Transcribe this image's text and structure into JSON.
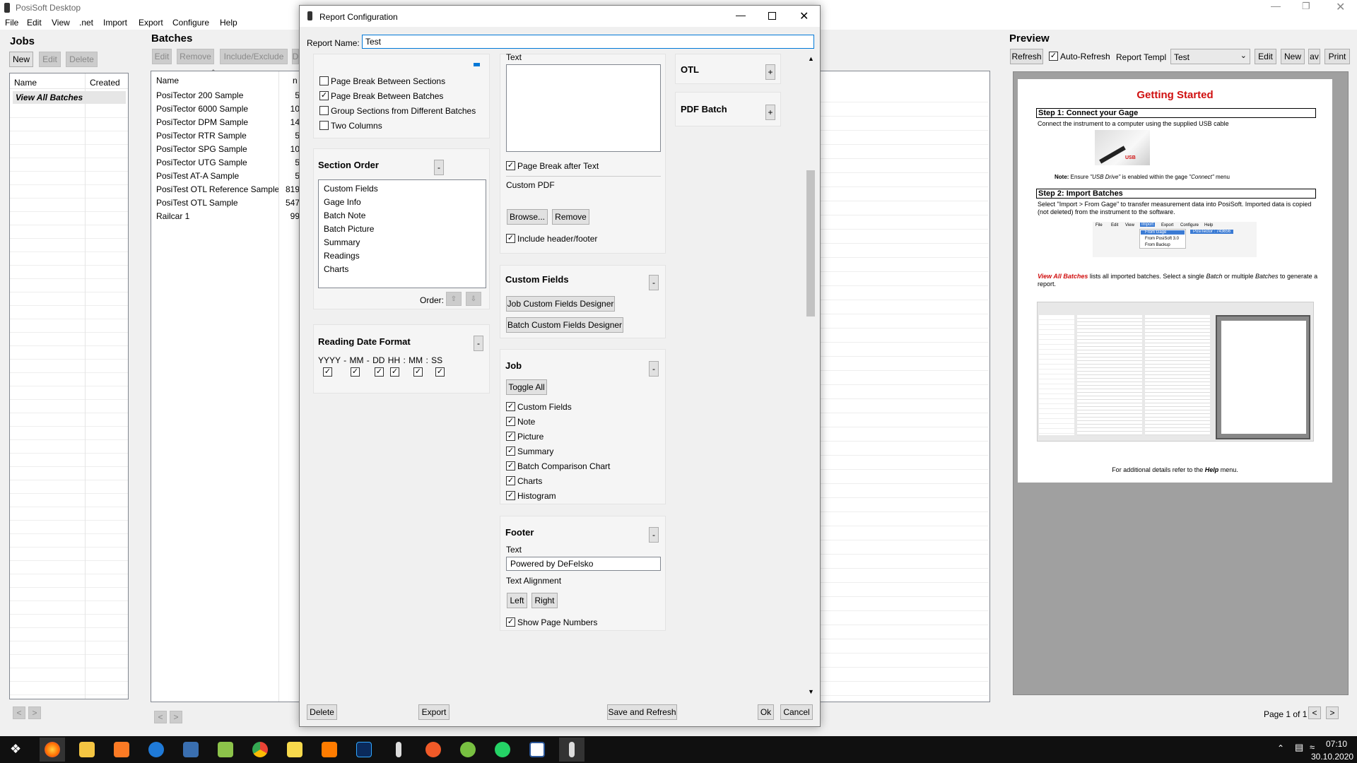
{
  "app": {
    "title": "PosiSoft Desktop",
    "menu": [
      "File",
      "Edit",
      "View",
      ".net",
      "Import",
      "Export",
      "Configure",
      "Help"
    ]
  },
  "jobs": {
    "title": "Jobs",
    "buttons": {
      "new": "New",
      "edit": "Edit",
      "delete": "Delete"
    },
    "columns": [
      "Name",
      "Created"
    ],
    "rows": [
      "View All Batches"
    ],
    "nav": {
      "prev": "<",
      "next": ">"
    }
  },
  "batches": {
    "title": "Batches",
    "buttons": {
      "edit": "Edit",
      "remove": "Remove",
      "include": "Include/Exclude",
      "extra": "D"
    },
    "columns": [
      "Name",
      "n"
    ],
    "rows": [
      {
        "name": "PosiTector 200 Sample",
        "n": "5"
      },
      {
        "name": "PosiTector 6000 Sample",
        "n": "10"
      },
      {
        "name": "PosiTector DPM Sample",
        "n": "14"
      },
      {
        "name": "PosiTector RTR Sample",
        "n": "5"
      },
      {
        "name": "PosiTector SPG Sample",
        "n": "10"
      },
      {
        "name": "PosiTector UTG Sample",
        "n": "5"
      },
      {
        "name": "PosiTest AT-A Sample",
        "n": "5"
      },
      {
        "name": "PosiTest OTL Reference Sample",
        "n": "819"
      },
      {
        "name": "PosiTest OTL Sample",
        "n": "547"
      },
      {
        "name": "Railcar 1",
        "n": "99"
      }
    ],
    "nav": {
      "prev": "<",
      "next": ">"
    }
  },
  "preview": {
    "title": "Preview",
    "refresh": "Refresh",
    "auto_refresh": "Auto-Refresh",
    "report_templ_label": "Report Templ",
    "report_templ_value": "Test",
    "edit": "Edit",
    "new": "New",
    "av": "av",
    "print": "Print",
    "page_info": "Page 1 of 1",
    "prev": "<",
    "next": ">",
    "doc": {
      "heading": "Getting Started",
      "step1": "Step 1: Connect your Gage",
      "step1_text": "Connect the instrument to a computer using the supplied USB cable",
      "usb_label": "USB",
      "note_bold": "Note:",
      "note_pre": " Ensure ",
      "note_usb": "\"USB Drive\"",
      "note_mid": " is enabled within the gage ",
      "note_connect": "\"Connect\"",
      "note_post": " menu",
      "step2": "Step 2: Import Batches",
      "step2_text": "Select \"Import > From Gage\" to transfer measurement data into PosiSoft.  Imported data is copied (not deleted) from the instrument to the software.",
      "menu_items": [
        "File",
        "Edit",
        "View",
        "Import",
        "Export",
        "Configure",
        "Help"
      ],
      "menu_sub": [
        "From Gage",
        "From PosiSoft 3.0",
        "From Backup"
      ],
      "menu_flyout": "PosiTector : 743656",
      "va_bold": "View All Batches",
      "va_text1": " lists all imported batches.  Select a single ",
      "va_batch": "Batch",
      "va_text2": " or multiple ",
      "va_batches": "Batches",
      "va_text3": " to generate a report.",
      "footer_pre": "For additional details refer to the ",
      "footer_help": "Help",
      "footer_post": " menu."
    }
  },
  "dialog": {
    "title": "Report Configuration",
    "report_name_label": "Report Name:",
    "report_name_value": "Test",
    "col1": {
      "page_break_sections": "Page Break Between Sections",
      "page_break_batches": "Page Break Between Batches",
      "group_sections": "Group Sections from Different Batches",
      "two_columns": "Two Columns",
      "section_order_title": "Section Order",
      "section_order_items": [
        "Custom Fields",
        "Gage Info",
        "Batch Note",
        "Batch Picture",
        "Summary",
        "Readings",
        "Charts"
      ],
      "order_label": "Order:",
      "reading_date_title": "Reading Date Format",
      "date_parts": "YYYY - MM - DD HH : MM : SS",
      "collapse": "-"
    },
    "col2": {
      "text_label": "Text",
      "page_break_after_text": "Page Break after Text",
      "custom_pdf": "Custom PDF",
      "browse": "Browse...",
      "remove": "Remove",
      "include_header_footer": "Include header/footer",
      "custom_fields_title": "Custom Fields",
      "job_cf_designer": "Job Custom Fields Designer",
      "batch_cf_designer": "Batch Custom Fields Designer",
      "job_title": "Job",
      "toggle_all": "Toggle All",
      "job_items": [
        "Custom Fields",
        "Note",
        "Picture",
        "Summary",
        "Batch Comparison Chart",
        "Charts",
        "Histogram"
      ],
      "footer_title": "Footer",
      "footer_text_label": "Text",
      "footer_text_value": "Powered by DeFelsko",
      "text_alignment": "Text Alignment",
      "left": "Left",
      "right": "Right",
      "show_page_numbers": "Show Page Numbers"
    },
    "col3": {
      "otl": "OTL",
      "pdf_batch": "PDF Batch",
      "expand": "+"
    },
    "buttons": {
      "delete": "Delete",
      "export": "Export",
      "save_refresh": "Save and Refresh",
      "ok": "Ok",
      "cancel": "Cancel"
    }
  },
  "taskbar": {
    "time": "07:10",
    "date": "30.10.2020"
  }
}
